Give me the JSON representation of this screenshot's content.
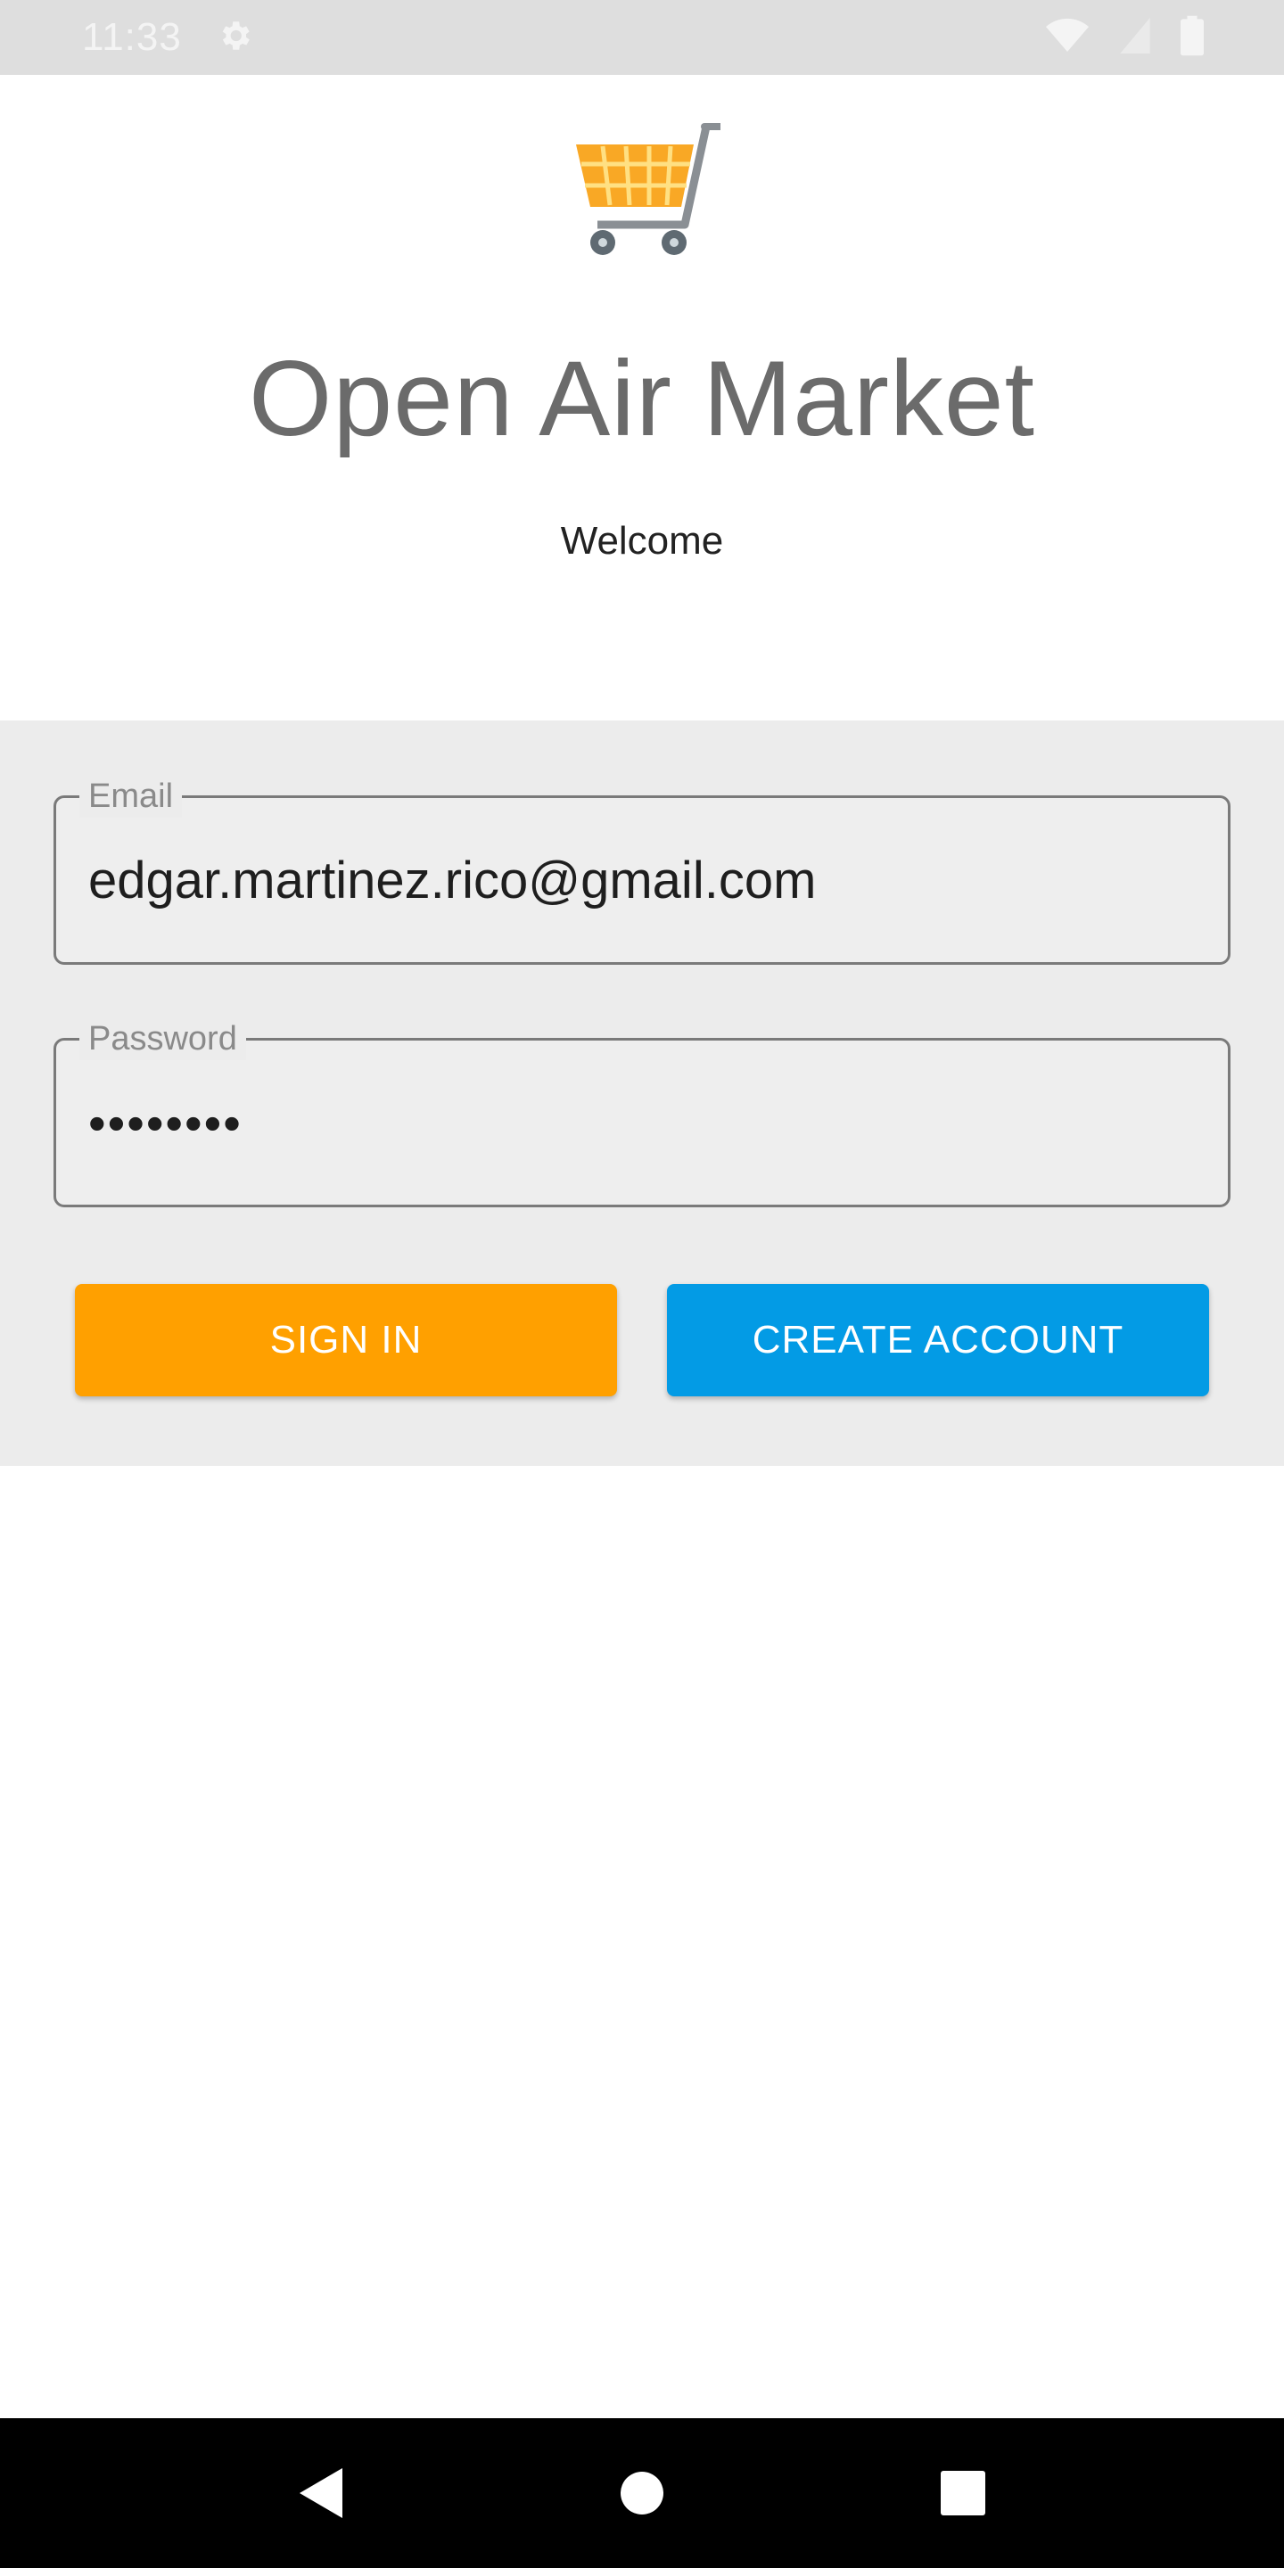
{
  "status_bar": {
    "time": "11:33",
    "icons": [
      "settings-gear-icon",
      "wifi-icon",
      "cell-signal-icon",
      "battery-icon"
    ]
  },
  "header": {
    "logo_icon": "shopping-cart-icon",
    "title": "Open Air Market",
    "subtitle": "Welcome"
  },
  "form": {
    "email_label": "Email",
    "email_value": "edgar.martinez.rico@gmail.com",
    "password_label": "Password",
    "password_value": "••••••••"
  },
  "buttons": {
    "sign_in": "SIGN IN",
    "create_account": "CREATE ACCOUNT"
  },
  "nav_bar": {
    "icons": [
      "back-icon",
      "home-icon",
      "recents-icon"
    ]
  },
  "colors": {
    "sign_in": "#ffa000",
    "create_account": "#039be5",
    "form_panel": "#ececec",
    "title": "#6b6b6b"
  }
}
